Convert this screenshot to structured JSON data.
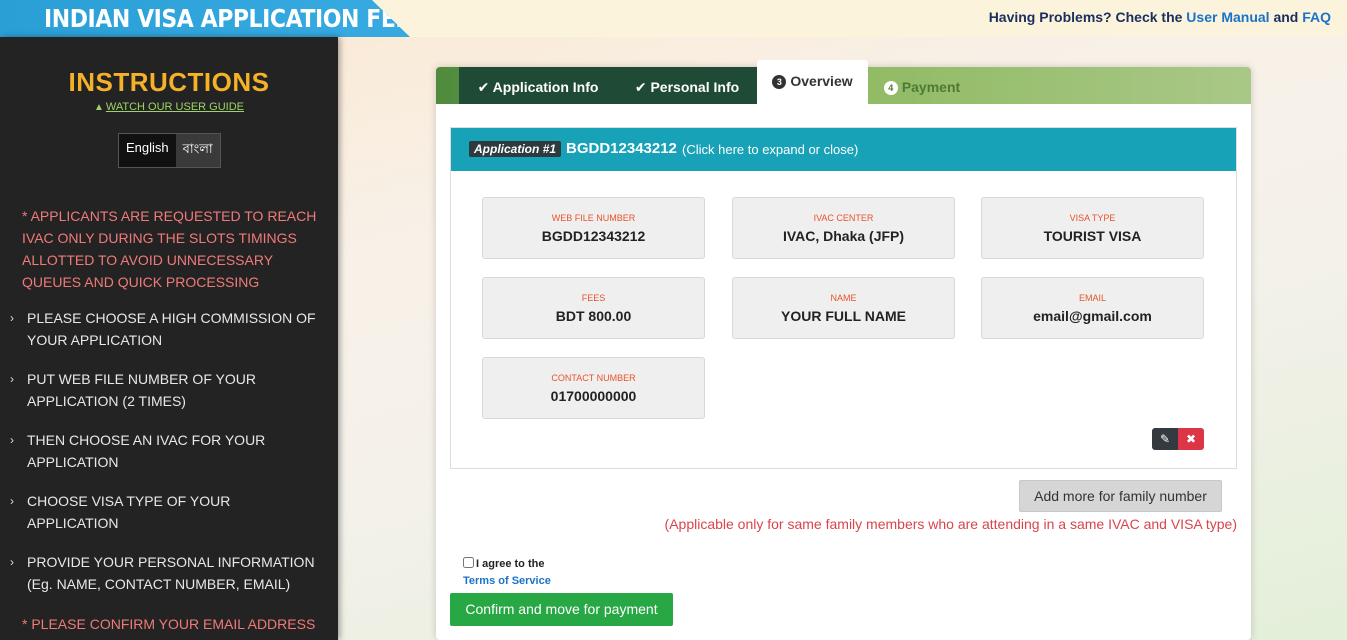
{
  "header": {
    "title": "INDIAN VISA APPLICATION FEE",
    "help_prefix": "Having Problems? Check the",
    "user_manual": "User Manual",
    "and": "and",
    "faq": "FAQ",
    "brand_color": "#2a9fd6"
  },
  "sidebar": {
    "title": "INSTRUCTIONS",
    "guide_link": "WATCH OUR USER GUIDE",
    "languages": [
      "English",
      "বাংলা"
    ],
    "selected_language": "English",
    "notice": "* APPLICANTS ARE REQUESTED TO REACH IVAC ONLY DURING THE SLOTS TIMINGS ALLOTTED TO AVOID UNNECESSARY QUEUES AND QUICK PROCESSING",
    "steps": [
      "PLEASE CHOOSE A HIGH COMMISSION OF YOUR APPLICATION",
      "PUT WEB FILE NUMBER OF YOUR APPLICATION (2 TIMES)",
      "THEN CHOOSE AN IVAC FOR YOUR APPLICATION",
      "CHOOSE VISA TYPE OF YOUR APPLICATION",
      "PROVIDE YOUR PERSONAL INFORMATION (Eg. NAME, CONTACT NUMBER, EMAIL)"
    ],
    "confirm_note": "* PLEASE CONFIRM YOUR EMAIL ADDRESS"
  },
  "tabs": [
    {
      "label": "Application Info",
      "state": "done"
    },
    {
      "label": "Personal Info",
      "state": "done"
    },
    {
      "label": "Overview",
      "state": "current",
      "number": "3"
    },
    {
      "label": "Payment",
      "state": "future",
      "number": "4"
    }
  ],
  "application": {
    "badge": "Application #1",
    "number": "BGDD12343212",
    "hint": "(Click here to expand or close)",
    "fields": [
      {
        "label": "WEB FILE NUMBER",
        "value": "BGDD12343212"
      },
      {
        "label": "IVAC CENTER",
        "value": "IVAC, Dhaka (JFP)"
      },
      {
        "label": "VISA TYPE",
        "value": "TOURIST VISA"
      },
      {
        "label": "FEES",
        "value": "BDT 800.00"
      },
      {
        "label": "NAME",
        "value": "YOUR FULL NAME"
      },
      {
        "label": "EMAIL",
        "value": "email@gmail.com"
      },
      {
        "label": "CONTACT NUMBER",
        "value": "01700000000"
      }
    ]
  },
  "actions": {
    "add_more": "Add more for family number",
    "applicable_note": "(Applicable only for same family members who are attending in a same IVAC and VISA type)",
    "agree": "I agree to the",
    "terms": "Terms of Service",
    "agree_checked": false,
    "confirm": "Confirm and move for payment"
  }
}
